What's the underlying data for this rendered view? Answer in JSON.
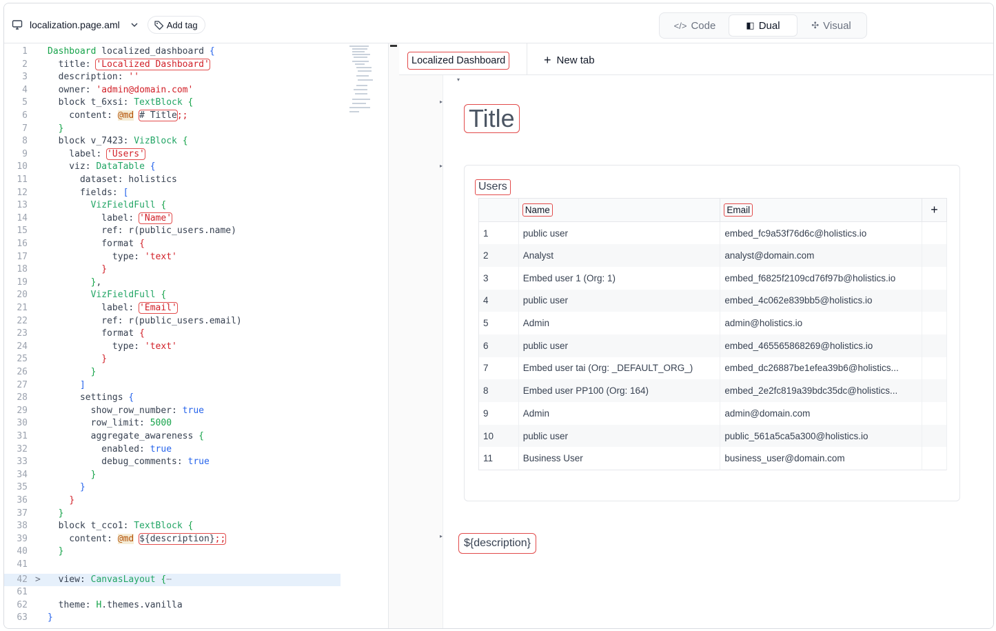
{
  "header": {
    "file_name": "localization.page.aml",
    "add_tag_label": "Add tag",
    "modes": [
      {
        "icon": "</>",
        "label": "Code"
      },
      {
        "icon": "◧",
        "label": "Dual"
      },
      {
        "icon": "✣",
        "label": "Visual"
      }
    ],
    "active_mode": "Dual"
  },
  "editor": {
    "line_numbers": [
      "1",
      "2",
      "3",
      "4",
      "5",
      "6",
      "7",
      "8",
      "9",
      "10",
      "11",
      "12",
      "13",
      "14",
      "15",
      "16",
      "17",
      "18",
      "19",
      "20",
      "21",
      "22",
      "23",
      "24",
      "25",
      "26",
      "27",
      "28",
      "29",
      "30",
      "31",
      "32",
      "33",
      "34",
      "35",
      "36",
      "37",
      "38",
      "39",
      "40",
      "41",
      "42",
      "61",
      "62",
      "63"
    ],
    "highlighted_line": "42"
  },
  "visual": {
    "tab_label": "Localized Dashboard",
    "new_tab_label": "New tab",
    "title_text": "Title",
    "users_card": {
      "title": "Users",
      "columns": [
        "Name",
        "Email"
      ],
      "rows": [
        {
          "n": "1",
          "name": "public user",
          "email": "embed_fc9a53f76d6c@holistics.io"
        },
        {
          "n": "2",
          "name": "Analyst",
          "email": "analyst@domain.com"
        },
        {
          "n": "3",
          "name": "Embed user 1 (Org: 1)",
          "email": "embed_f6825f2109cd76f97b@holistics.io"
        },
        {
          "n": "4",
          "name": "public user",
          "email": "embed_4c062e839bb5@holistics.io"
        },
        {
          "n": "5",
          "name": "Admin",
          "email": "admin@holistics.io"
        },
        {
          "n": "6",
          "name": "public user",
          "email": "embed_465565868269@holistics.io"
        },
        {
          "n": "7",
          "name": "Embed user tai (Org: _DEFAULT_ORG_)",
          "email": "embed_dc26887be1efea39b6@holistics..."
        },
        {
          "n": "8",
          "name": "Embed user PP100 (Org: 164)",
          "email": "embed_2e2fc819a39bdc35dc@holistics..."
        },
        {
          "n": "9",
          "name": "Admin",
          "email": "admin@domain.com"
        },
        {
          "n": "10",
          "name": "public user",
          "email": "public_561a5ca5a300@holistics.io"
        },
        {
          "n": "11",
          "name": "Business User",
          "email": "business_user@domain.com"
        }
      ]
    },
    "description_text": "${description}"
  }
}
